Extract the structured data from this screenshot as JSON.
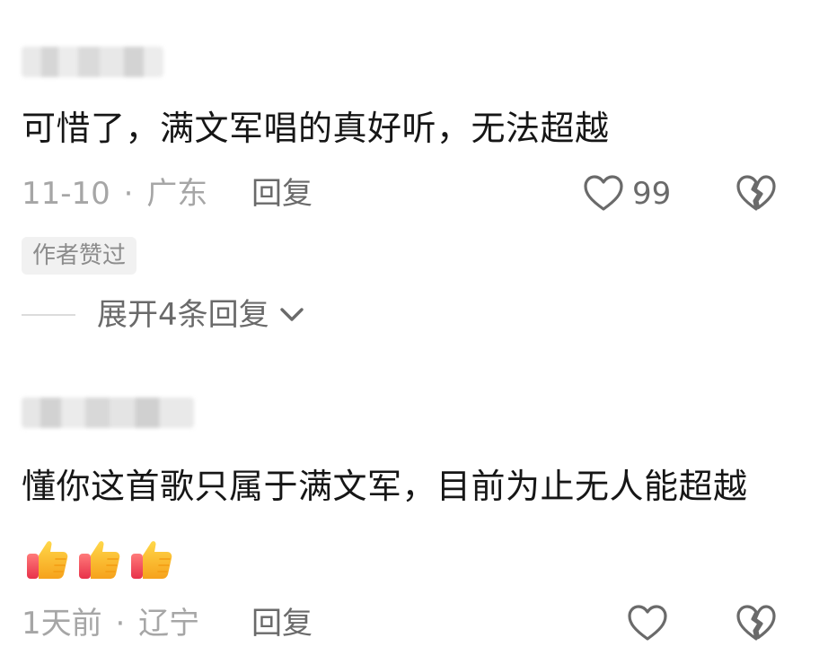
{
  "comments": [
    {
      "text": "可惜了，满文军唱的真好听，无法超越",
      "date": "11-10",
      "location": "广东",
      "reply_label": "回复",
      "like_count": "99",
      "author_badge": "作者赞过",
      "expand_label": "展开4条回复"
    },
    {
      "text": "懂你这首歌只属于满文军，目前为止无人能超越",
      "emoji": [
        "thumbs-up",
        "thumbs-up",
        "thumbs-up"
      ],
      "date": "1天前",
      "location": "辽宁",
      "reply_label": "回复"
    }
  ],
  "separator": "·",
  "icons": {
    "like": "heart-outline-icon",
    "dislike": "broken-heart-icon",
    "expand": "chevron-down-icon"
  }
}
